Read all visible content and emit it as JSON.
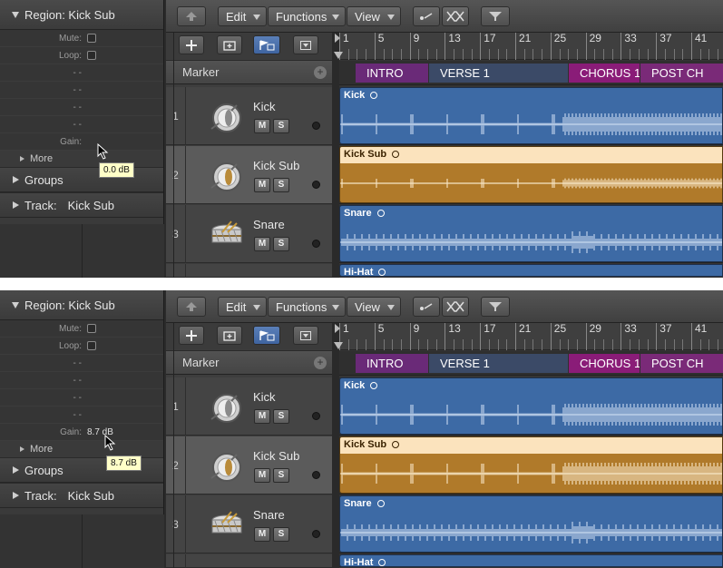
{
  "panels": [
    {
      "inspector": {
        "region_title": "Region: Kick Sub",
        "rows": [
          {
            "label": "Mute:",
            "type": "check"
          },
          {
            "label": "Loop:",
            "type": "check"
          },
          {
            "label": "- -",
            "type": "dash"
          },
          {
            "label": "- -",
            "type": "dash"
          },
          {
            "label": "- -",
            "type": "dash"
          },
          {
            "label": "- -",
            "type": "dash"
          },
          {
            "label": "Gain:",
            "type": "value",
            "value": ""
          }
        ],
        "more_label": "More",
        "groups_label": "Groups",
        "track_label": "Track:",
        "track_name": "Kick Sub",
        "tooltip": "0.0 dB"
      }
    },
    {
      "inspector": {
        "region_title": "Region: Kick Sub",
        "rows": [
          {
            "label": "Mute:",
            "type": "check"
          },
          {
            "label": "Loop:",
            "type": "check"
          },
          {
            "label": "- -",
            "type": "dash"
          },
          {
            "label": "- -",
            "type": "dash"
          },
          {
            "label": "- -",
            "type": "dash"
          },
          {
            "label": "- -",
            "type": "dash"
          },
          {
            "label": "Gain:",
            "type": "value",
            "value": "8.7 dB"
          }
        ],
        "more_label": "More",
        "groups_label": "Groups",
        "track_label": "Track:",
        "track_name": "Kick Sub",
        "tooltip": "8.7 dB"
      }
    }
  ],
  "menus": {
    "edit": "Edit",
    "functions": "Functions",
    "view": "View"
  },
  "marker_label": "Marker",
  "ruler_numbers": [
    "1",
    "5",
    "9",
    "13",
    "17",
    "21",
    "25",
    "29",
    "33",
    "37",
    "41"
  ],
  "markers": [
    {
      "name": "INTRO",
      "color": "#6a2a78"
    },
    {
      "name": "VERSE 1",
      "color": "#3b4a67"
    },
    {
      "name": "CHORUS 1",
      "color": "#8a1c78"
    },
    {
      "name": "POST CH",
      "color": "#7a2a78"
    }
  ],
  "tracks": [
    {
      "num": "1",
      "name": "Kick",
      "icon": "kick-drum-icon",
      "mute": "M",
      "solo": "S"
    },
    {
      "num": "2",
      "name": "Kick Sub",
      "icon": "kick-drum-icon",
      "mute": "M",
      "solo": "S"
    },
    {
      "num": "3",
      "name": "Snare",
      "icon": "snare-drum-icon",
      "mute": "M",
      "solo": "S"
    }
  ],
  "regions": [
    "Kick",
    "Kick Sub",
    "Snare",
    "Hi-Hat"
  ],
  "colors": {
    "region_blue": "#3d6aa5",
    "region_gold": "#b07a2a",
    "region_gold_header": "#fbe3bd"
  }
}
